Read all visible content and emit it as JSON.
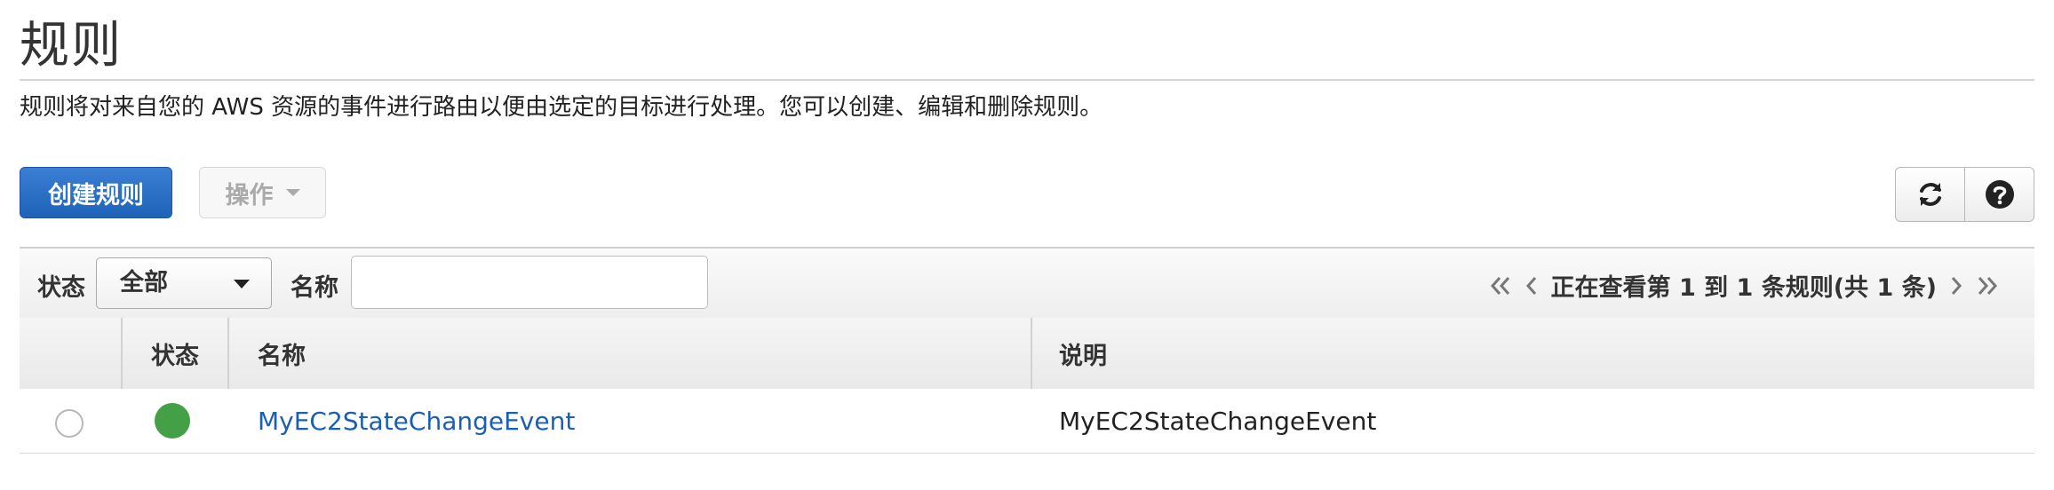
{
  "page": {
    "title": "规则",
    "description": "规则将对来自您的 AWS 资源的事件进行路由以便由选定的目标进行处理。您可以创建、编辑和删除规则。"
  },
  "toolbar": {
    "create_label": "创建规则",
    "actions_label": "操作",
    "refresh_icon": "refresh-icon",
    "help_icon": "help-icon"
  },
  "filter": {
    "status_label": "状态",
    "status_value": "全部",
    "name_label": "名称",
    "name_value": "",
    "pager_text": "正在查看第 1 到 1 条规则(共 1 条)"
  },
  "table": {
    "columns": [
      "状态",
      "名称",
      "说明"
    ],
    "rows": [
      {
        "selected": false,
        "status_color": "#43a047",
        "name": "MyEC2StateChangeEvent",
        "description": "MyEC2StateChangeEvent"
      }
    ]
  },
  "colors": {
    "primary": "#1f63b9",
    "link": "#1a5fb4",
    "status_enabled": "#43a047"
  }
}
